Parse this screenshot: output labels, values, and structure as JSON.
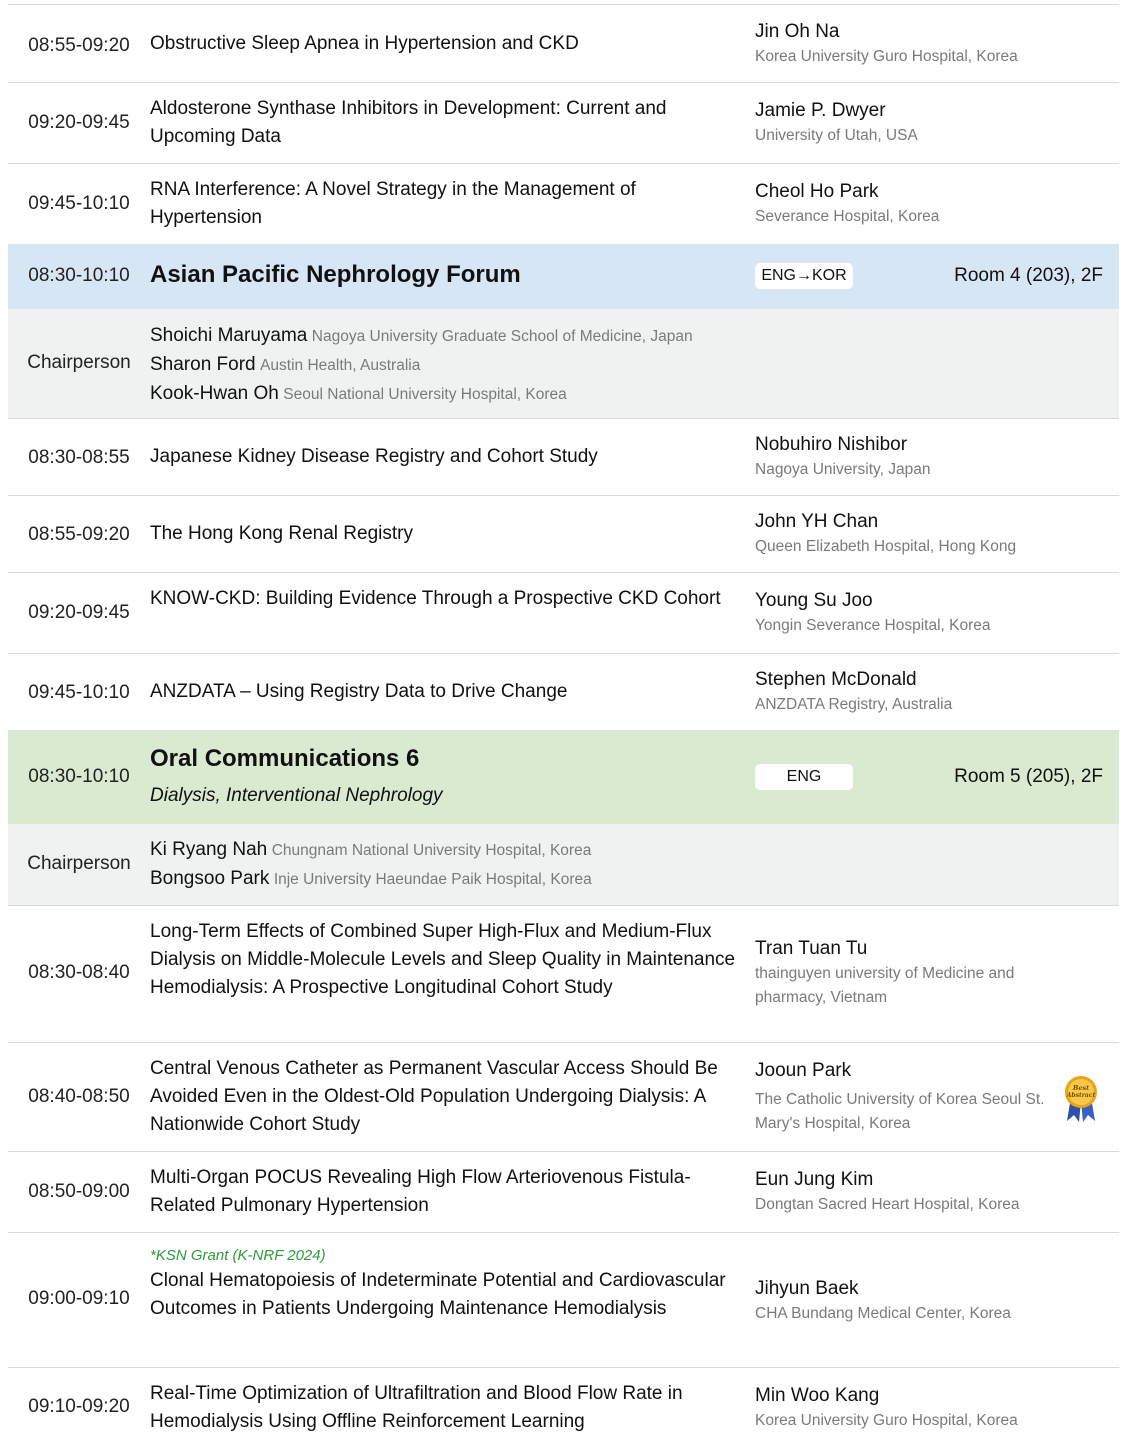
{
  "rows_top": [
    {
      "time": "08:55-09:20",
      "title": "Obstructive Sleep Apnea in Hypertension and CKD",
      "speaker": "Jin Oh Na",
      "affiliation": "Korea University Guro Hospital, Korea"
    },
    {
      "time": "09:20-09:45",
      "title": "Aldosterone Synthase Inhibitors in Development: Current and Upcoming Data",
      "speaker": "Jamie P. Dwyer",
      "affiliation": "University of Utah, USA"
    },
    {
      "time": "09:45-10:10",
      "title": "RNA Interference: A Novel Strategy in the Management of Hypertension",
      "speaker": "Cheol Ho Park",
      "affiliation": "Severance Hospital, Korea"
    }
  ],
  "session1": {
    "time": "08:30-10:10",
    "title": "Asian Pacific Nephrology Forum",
    "language": "ENG→KOR",
    "room": "Room 4 (203), 2F",
    "chair_label": "Chairperson",
    "chairs": [
      {
        "name": "Shoichi Maruyama",
        "affiliation": "Nagoya University Graduate School of Medicine, Japan"
      },
      {
        "name": "Sharon Ford",
        "affiliation": "Austin Health, Australia"
      },
      {
        "name": "Kook-Hwan Oh",
        "affiliation": "Seoul National University Hospital, Korea"
      }
    ],
    "talks": [
      {
        "time": "08:30-08:55",
        "title": "Japanese Kidney Disease Registry and Cohort Study",
        "speaker": "Nobuhiro Nishibor",
        "affiliation": "Nagoya University, Japan"
      },
      {
        "time": "08:55-09:20",
        "title": "The Hong Kong Renal Registry",
        "speaker": "John YH Chan",
        "affiliation": "Queen Elizabeth Hospital, Hong Kong"
      },
      {
        "time": "09:20-09:45",
        "title": "KNOW-CKD: Building Evidence Through a Prospective CKD Cohort",
        "speaker": "Young Su Joo",
        "affiliation": "Yongin Severance Hospital, Korea"
      },
      {
        "time": "09:45-10:10",
        "title": "ANZDATA – Using Registry Data to Drive Change",
        "speaker": "Stephen McDonald",
        "affiliation": "ANZDATA Registry, Australia"
      }
    ]
  },
  "session2": {
    "time": "08:30-10:10",
    "title": "Oral Communications 6",
    "subtitle": "Dialysis, Interventional Nephrology",
    "language": "ENG",
    "room": "Room 5 (205), 2F",
    "chair_label": "Chairperson",
    "chairs": [
      {
        "name": "Ki Ryang Nah",
        "affiliation": "Chungnam National University Hospital, Korea"
      },
      {
        "name": "Bongsoo Park",
        "affiliation": "Inje University Haeundae Paik Hospital, Korea"
      }
    ],
    "talks": [
      {
        "time": "08:30-08:40",
        "title": "Long-Term Effects of Combined Super High-Flux and Medium-Flux Dialysis on Middle-Molecule Levels and Sleep Quality in Maintenance Hemodialysis: A Prospective Longitudinal Cohort Study",
        "speaker": "Tran Tuan Tu",
        "affiliation": "thainguyen university of Medicine and pharmacy, Vietnam"
      },
      {
        "time": "08:40-08:50",
        "title": "Central Venous Catheter as Permanent Vascular Access Should Be Avoided Even in the Oldest-Old Population Undergoing Dialysis: A Nationwide Cohort Study",
        "speaker": "Jooun Park",
        "affiliation": "The Catholic University of Korea Seoul St. Mary's Hospital, Korea",
        "award": "Best Abstract"
      },
      {
        "time": "08:50-09:00",
        "title": "Multi-Organ POCUS Revealing High Flow Arteriovenous Fistula-Related Pulmonary Hypertension",
        "speaker": "Eun Jung Kim",
        "affiliation": "Dongtan Sacred Heart Hospital, Korea"
      },
      {
        "time": "09:00-09:10",
        "grant": "*KSN Grant (K-NRF 2024)",
        "title": "Clonal Hematopoiesis of Indeterminate Potential and Cardiovascular Outcomes in Patients Undergoing Maintenance Hemodialysis",
        "speaker": "Jihyun Baek",
        "affiliation": "CHA Bundang Medical Center, Korea"
      },
      {
        "time": "09:10-09:20",
        "title": "Real-Time Optimization of Ultrafiltration and Blood Flow Rate in Hemodialysis Using Offline Reinforcement Learning",
        "speaker": "Min Woo Kang",
        "affiliation": "Korea University Guro Hospital, Korea"
      }
    ]
  },
  "colors": {
    "session_blue": "#d7e6f5",
    "session_green": "#d9ead0",
    "chair_bg": "#f0f2f1",
    "grant_green": "#2e9a3a"
  }
}
